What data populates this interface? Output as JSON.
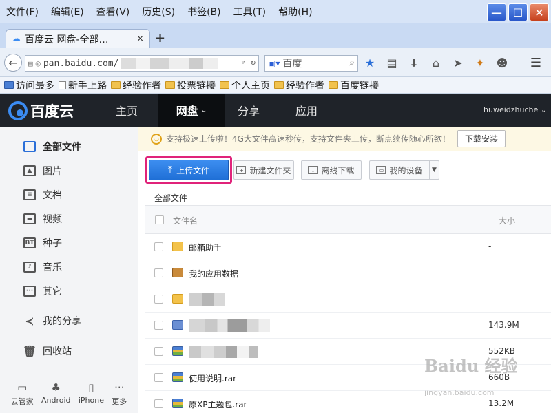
{
  "menu": [
    "文件(F)",
    "编辑(E)",
    "查看(V)",
    "历史(S)",
    "书签(B)",
    "工具(T)",
    "帮助(H)"
  ],
  "window_controls": {
    "minimize": "—",
    "maximize": "☐",
    "close": "✕"
  },
  "tab": {
    "title": "百度云 网盘-全部…",
    "close": "×",
    "new_tab": "+"
  },
  "address": {
    "url_visible": "pan.baidu.com/",
    "search_placeholder": "百度"
  },
  "bookmarks": [
    "访问最多",
    "新手上路",
    "经验作者",
    "投票链接",
    "个人主页",
    "经验作者",
    "百度链接"
  ],
  "site": {
    "logo_text": "百度云",
    "nav": [
      "主页",
      "网盘",
      "分享",
      "应用"
    ],
    "active_nav": "网盘",
    "user": "huweidzhuche"
  },
  "sidebar": {
    "items": [
      {
        "label": "全部文件",
        "icon": "folder-tab-icon",
        "active": true
      },
      {
        "label": "图片",
        "icon": "image-icon"
      },
      {
        "label": "文档",
        "icon": "document-icon"
      },
      {
        "label": "视频",
        "icon": "video-icon"
      },
      {
        "label": "种子",
        "icon": "bt-icon",
        "glyph": "BT"
      },
      {
        "label": "音乐",
        "icon": "music-icon"
      },
      {
        "label": "其它",
        "icon": "other-icon"
      },
      {
        "label": "我的分享",
        "icon": "share-icon"
      },
      {
        "label": "回收站",
        "icon": "trash-icon"
      }
    ],
    "footer": [
      {
        "label": "云管家",
        "icon": "monitor-icon"
      },
      {
        "label": "Android",
        "icon": "android-icon"
      },
      {
        "label": "iPhone",
        "icon": "iphone-icon"
      },
      {
        "label": "更多",
        "icon": "more-icon"
      }
    ]
  },
  "notice": {
    "text": "支持极速上传啦！4G大文件高速秒传，支持文件夹上传，断点续传随心所欲！",
    "button": "下载安装"
  },
  "toolbar": {
    "upload": "上传文件",
    "new_folder": "新建文件夹",
    "offline_download": "离线下载",
    "my_devices": "我的设备"
  },
  "breadcrumb": "全部文件",
  "table": {
    "headers": {
      "name": "文件名",
      "size": "大小"
    },
    "rows": [
      {
        "name": "邮箱助手",
        "size": "-",
        "type": "folder"
      },
      {
        "name": "我的应用数据",
        "size": "-",
        "type": "appdata"
      },
      {
        "name": "",
        "size": "-",
        "type": "folder",
        "masked": true
      },
      {
        "name": "",
        "size": "143.9M",
        "type": "video",
        "masked": true
      },
      {
        "name": "",
        "size": "552KB",
        "type": "archive",
        "masked": true
      },
      {
        "name": "使用说明.rar",
        "size": "660B",
        "type": "archive"
      },
      {
        "name": "原XP主题包.rar",
        "size": "13.2M",
        "type": "archive"
      }
    ]
  },
  "watermark": {
    "main": "Baidu 经验",
    "sub": "jingyan.baidu.com"
  }
}
